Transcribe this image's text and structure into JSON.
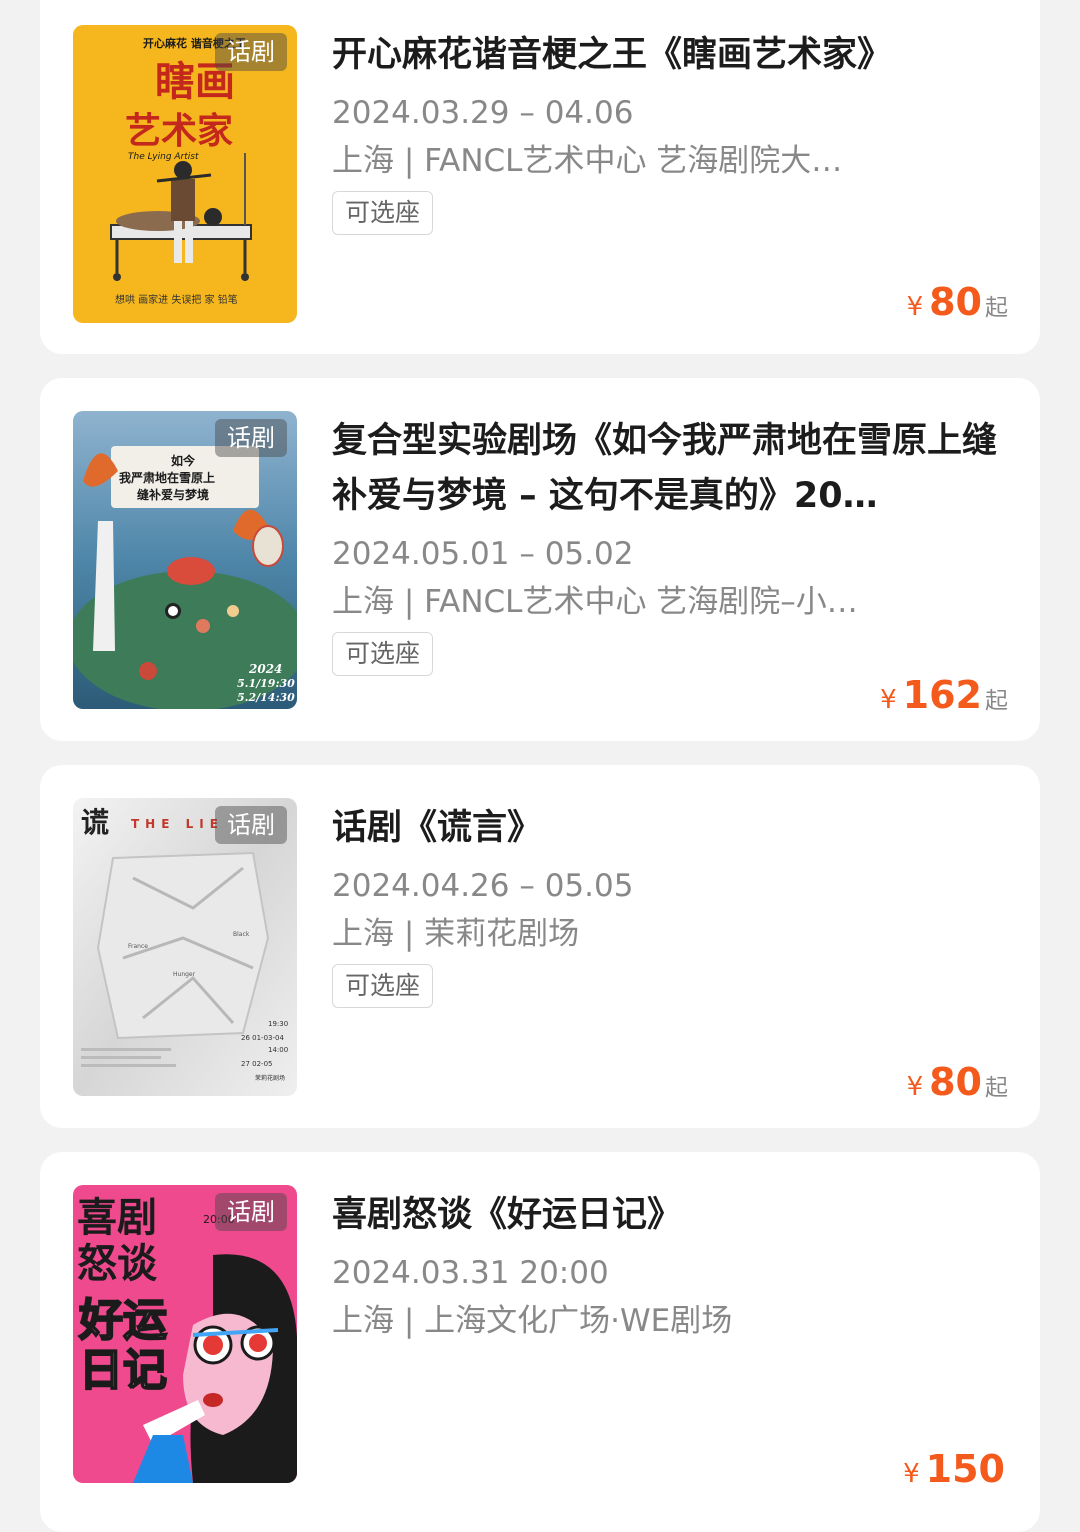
{
  "shows": [
    {
      "category": "话剧",
      "title": "开心麻花谐音梗之王《瞎画艺术家》",
      "date": "2024.03.29 – 04.06",
      "venue": "上海 | FANCL艺术中心 艺海剧院大…",
      "badge": "可选座",
      "currency": "¥",
      "price": "80",
      "price_suffix": "起",
      "poster": {
        "bg_color": "#f5b71d",
        "text": [
          "开心麻花 谐音梗之王",
          "瞎画",
          "艺术家",
          "The Lying Artist",
          "想哄 画家进 失误把 家 铅笔"
        ]
      }
    },
    {
      "category": "话剧",
      "title": "复合型实验剧场《如今我严肃地在雪原上缝补爱与梦境 – 这句不是真的》20…",
      "date": "2024.05.01 – 05.02",
      "venue": "上海 | FANCL艺术中心 艺海剧院–小…",
      "badge": "可选座",
      "currency": "¥",
      "price": "162",
      "price_suffix": "起",
      "poster": {
        "bg_color": "#5b8fb8",
        "text": [
          "如今",
          "我严肃地在雪原上",
          "缝补爱与梦境",
          "2024",
          "5.1/19:30",
          "5.2/14:30"
        ]
      }
    },
    {
      "category": "话剧",
      "title": "话剧《谎言》",
      "date": "2024.04.26 – 05.05",
      "venue": "上海 | 茉莉花剧场",
      "badge": "可选座",
      "currency": "¥",
      "price": "80",
      "price_suffix": "起",
      "poster": {
        "bg_color": "#e6e6e6",
        "text": [
          "谎",
          "THE LIE",
          "France",
          "Black",
          "Hunger",
          "19:30",
          "26 01-03-04",
          "14:00",
          "27 02-05",
          "茉莉花剧场"
        ]
      }
    },
    {
      "category": "话剧",
      "title": "喜剧怒谈《好运日记》",
      "date": "2024.03.31 20:00",
      "venue": "上海 | 上海文化广场·WE剧场",
      "badge": "",
      "currency": "¥",
      "price": "150",
      "price_suffix": "",
      "poster": {
        "bg_color": "#ee4a8d",
        "text": [
          "喜剧",
          "怒谈",
          "好运",
          "日记",
          "20:00"
        ]
      }
    }
  ]
}
